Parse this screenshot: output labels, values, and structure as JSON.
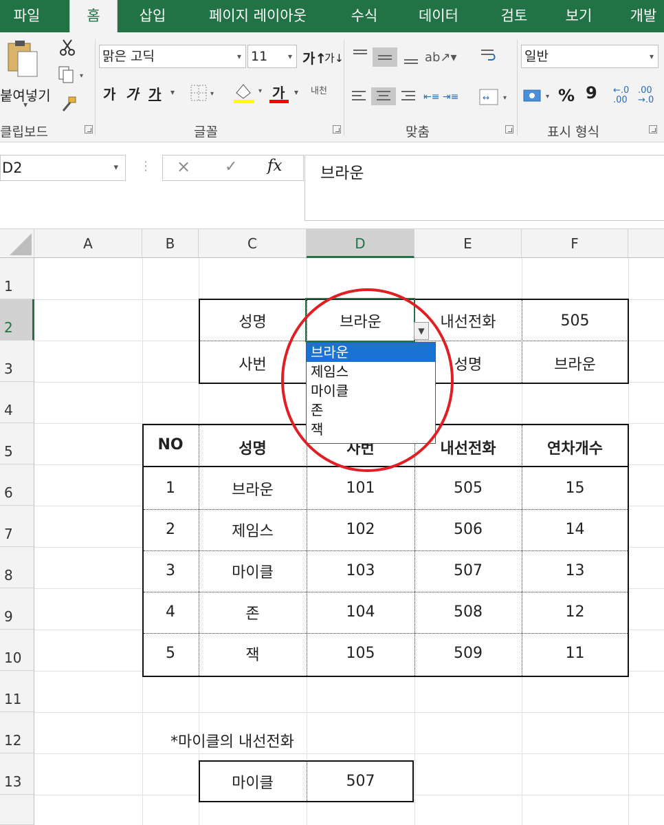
{
  "tabs": [
    {
      "label": "파일",
      "active": false
    },
    {
      "label": "홈",
      "active": true
    },
    {
      "label": "삽입",
      "active": false
    },
    {
      "label": "페이지 레이아웃",
      "active": false
    },
    {
      "label": "수식",
      "active": false
    },
    {
      "label": "데이터",
      "active": false
    },
    {
      "label": "검토",
      "active": false
    },
    {
      "label": "보기",
      "active": false
    },
    {
      "label": "개발",
      "active": false
    }
  ],
  "ribbon": {
    "clipboard": {
      "paste_label": "붙여넣기",
      "group_label": "클립보드"
    },
    "font": {
      "name": "맑은 고딕",
      "size": "11",
      "bold": "가",
      "italic": "가",
      "underline": "가",
      "font_color_char": "가",
      "phonetic": "내천",
      "group_label": "글꼴"
    },
    "alignment": {
      "group_label": "맞춤"
    },
    "number": {
      "format": "일반",
      "percent": "%",
      "comma": "9",
      "group_label": "표시 형식"
    }
  },
  "formula_bar": {
    "name_box": "D2",
    "fx": "fx",
    "value": "브라운"
  },
  "columns": [
    "A",
    "B",
    "C",
    "D",
    "E",
    "F"
  ],
  "selected_column": "D",
  "rows": [
    "1",
    "2",
    "3",
    "4",
    "5",
    "6",
    "7",
    "8",
    "9",
    "10",
    "11",
    "12",
    "13"
  ],
  "selected_row": "2",
  "lookup_table": {
    "label_name": "성명",
    "name_value": "브라운",
    "label_ext": "내선전화",
    "ext_value": "505",
    "label_empno": "사번",
    "label_name2": "성명",
    "name2_value": "브라운"
  },
  "dropdown": {
    "options": [
      "브라운",
      "제임스",
      "마이클",
      "존",
      "잭"
    ],
    "selected": "브라운"
  },
  "main_table": {
    "headers": [
      "NO",
      "성명",
      "사번",
      "내선전화",
      "연차개수"
    ],
    "rows": [
      [
        "1",
        "브라운",
        "101",
        "505",
        "15"
      ],
      [
        "2",
        "제임스",
        "102",
        "506",
        "14"
      ],
      [
        "3",
        "마이클",
        "103",
        "507",
        "13"
      ],
      [
        "4",
        "존",
        "104",
        "508",
        "12"
      ],
      [
        "5",
        "잭",
        "105",
        "509",
        "11"
      ]
    ]
  },
  "note": "*마이클의 내선전화",
  "result": {
    "name": "마이클",
    "value": "507"
  },
  "colors": {
    "accent": "#217346",
    "highlight": "#e01e23",
    "selection_blue": "#1a73d2"
  }
}
